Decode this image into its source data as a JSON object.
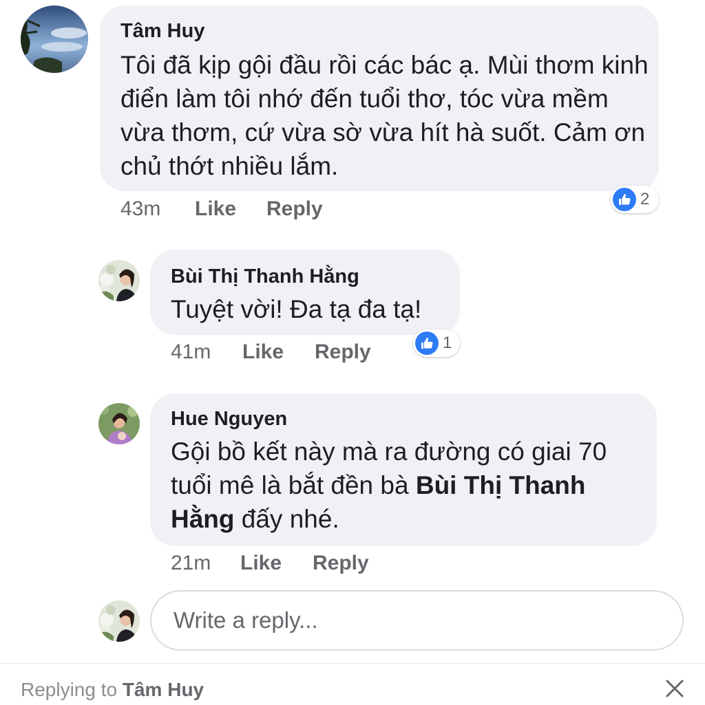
{
  "comments": [
    {
      "author": "Tâm Huy",
      "text": "Tôi đã kịp gội đầu rồi các bác ạ. Mùi thơm kinh điển làm tôi nhớ đến tuổi thơ, tóc vừa mềm vừa thơm, cứ vừa sờ vừa hít hà suốt. Cảm ơn chủ thớt nhiều lắm.",
      "time": "43m",
      "like_label": "Like",
      "reply_label": "Reply",
      "reaction_count": "2"
    },
    {
      "author": "Bùi Thị Thanh Hằng",
      "text": "Tuyệt vời! Đa tạ đa tạ!",
      "time": "41m",
      "like_label": "Like",
      "reply_label": "Reply",
      "reaction_count": "1"
    },
    {
      "author": "Hue Nguyen",
      "text_before": "Gội bồ kết này mà ra đường có giai 70 tuổi mê là bắt đền bà ",
      "mention": "Bùi Thị Thanh Hằng",
      "text_after": " đấy nhé.",
      "time": "21m",
      "like_label": "Like",
      "reply_label": "Reply"
    }
  ],
  "composer": {
    "placeholder": "Write a reply..."
  },
  "footer": {
    "replying_prefix": "Replying to ",
    "replying_name": "Tâm Huy"
  },
  "icons": {
    "reaction": "like-thumb-icon",
    "close": "close-icon"
  },
  "colors": {
    "like_blue": "#2d7cf6",
    "bubble": "#f0f1f4",
    "meta_gray": "#65676b"
  }
}
